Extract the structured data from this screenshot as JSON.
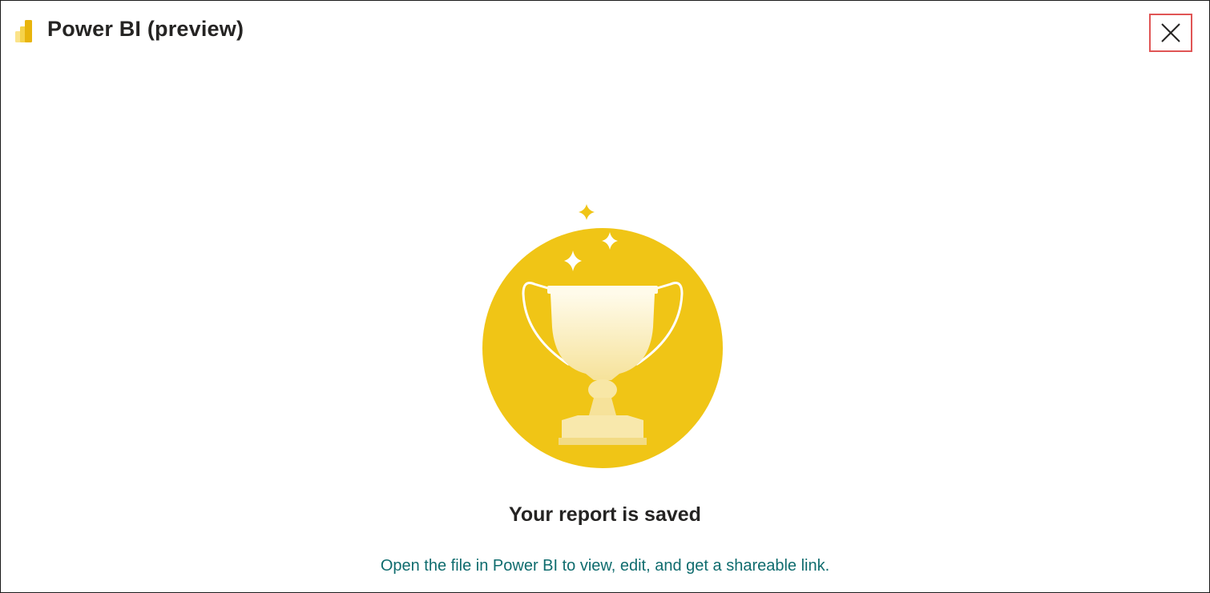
{
  "window": {
    "title": "Power BI (preview)",
    "logo_icon": "power-bi-logo-icon",
    "close_icon": "close-icon"
  },
  "content": {
    "illustration_icon": "trophy-icon",
    "headline": "Your report is saved",
    "message": "Open the file in Power BI to view, edit, and get a shareable link."
  },
  "colors": {
    "logo_gold": "#F2C811",
    "circle_yellow": "#F0C516",
    "message_teal": "#0F6C6E",
    "close_highlight": "#E05555"
  }
}
